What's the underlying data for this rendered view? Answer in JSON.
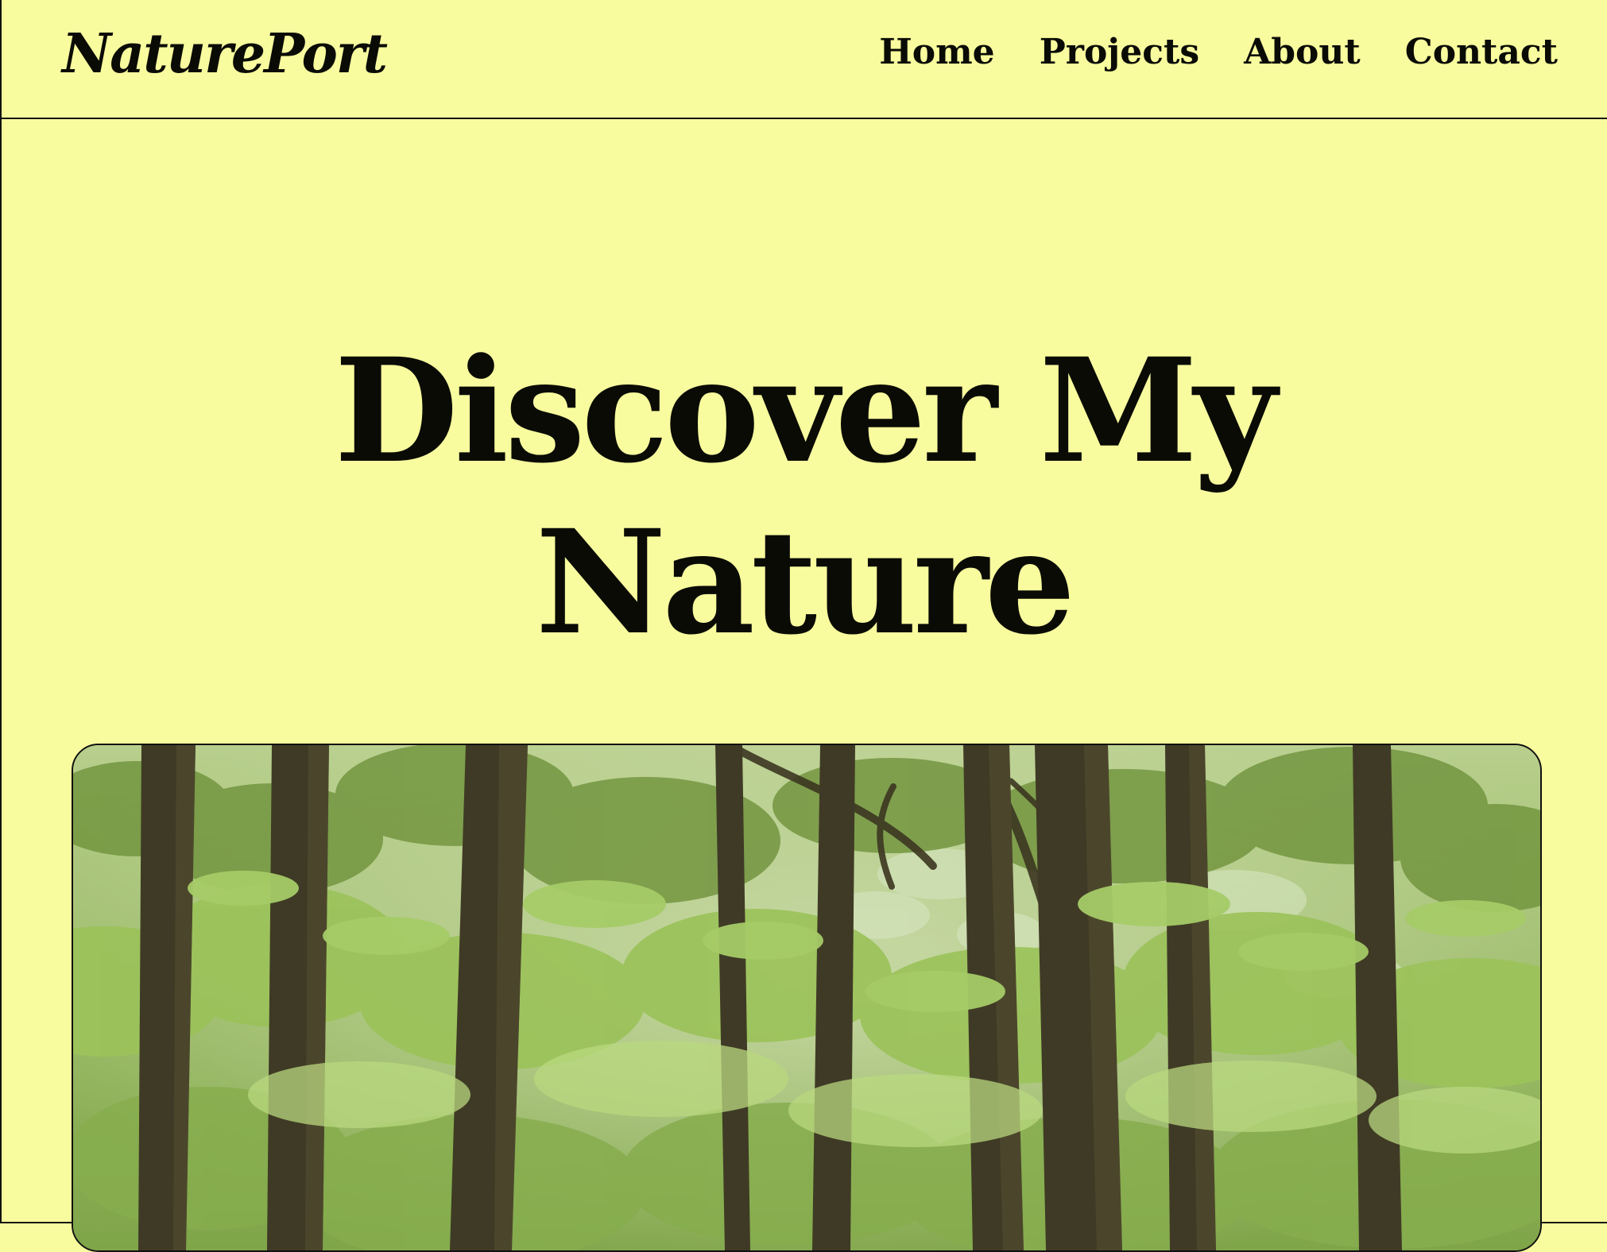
{
  "brand": {
    "name": "NaturePort"
  },
  "nav": {
    "items": [
      {
        "label": "Home"
      },
      {
        "label": "Projects"
      },
      {
        "label": "About"
      },
      {
        "label": "Contact"
      }
    ]
  },
  "hero": {
    "title_line1": "Discover My",
    "title_line2": "Nature",
    "image_icon": "forest-photo"
  },
  "colors": {
    "background": "#f8fc9e",
    "text": "#0b0b06",
    "foliage": "#9dbd65",
    "trunk": "#3f3a25"
  }
}
